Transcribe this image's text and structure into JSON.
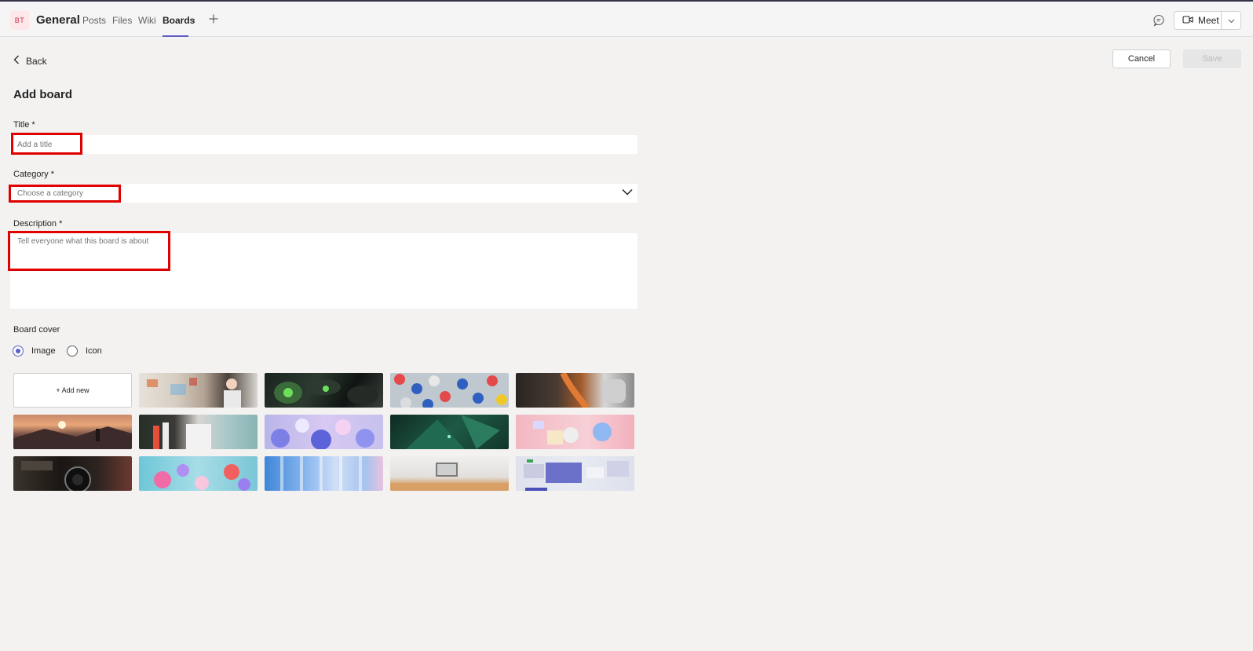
{
  "header": {
    "avatar_initials": "BT",
    "channel_name": "General",
    "tabs": [
      {
        "label": "Posts"
      },
      {
        "label": "Files"
      },
      {
        "label": "Wiki"
      },
      {
        "label": "Boards"
      }
    ],
    "active_tab": "Boards",
    "meet_label": "Meet"
  },
  "nav": {
    "back_label": "Back"
  },
  "actions": {
    "cancel_label": "Cancel",
    "save_label": "Save"
  },
  "form": {
    "page_title": "Add board",
    "title_label": "Title *",
    "title_placeholder": "Add a title",
    "title_value": "",
    "category_label": "Category *",
    "category_placeholder": "Choose a category",
    "description_label": "Description *",
    "description_placeholder": "Tell everyone what this board is about",
    "description_value": ""
  },
  "cover": {
    "section_label": "Board cover",
    "options": [
      {
        "label": "Image",
        "selected": true
      },
      {
        "label": "Icon",
        "selected": false
      }
    ],
    "add_new_label": "+ Add new",
    "images": [
      "office-sketch-board",
      "dark-green-machinery",
      "colored-caps-pattern",
      "orange-chrome-abstract",
      "mountain-sunset-hiker",
      "books-desk-scene",
      "purple-spheres",
      "green-geometric-shapes",
      "pink-3d-objects",
      "vintage-camera-closeup",
      "colorful-floating-balls",
      "blue-glass-columns",
      "bright-office-room",
      "ui-screens-collage"
    ]
  },
  "colors": {
    "accent": "#5b5fc7",
    "highlight_box": "#e00000",
    "background": "#f3f2f1"
  }
}
